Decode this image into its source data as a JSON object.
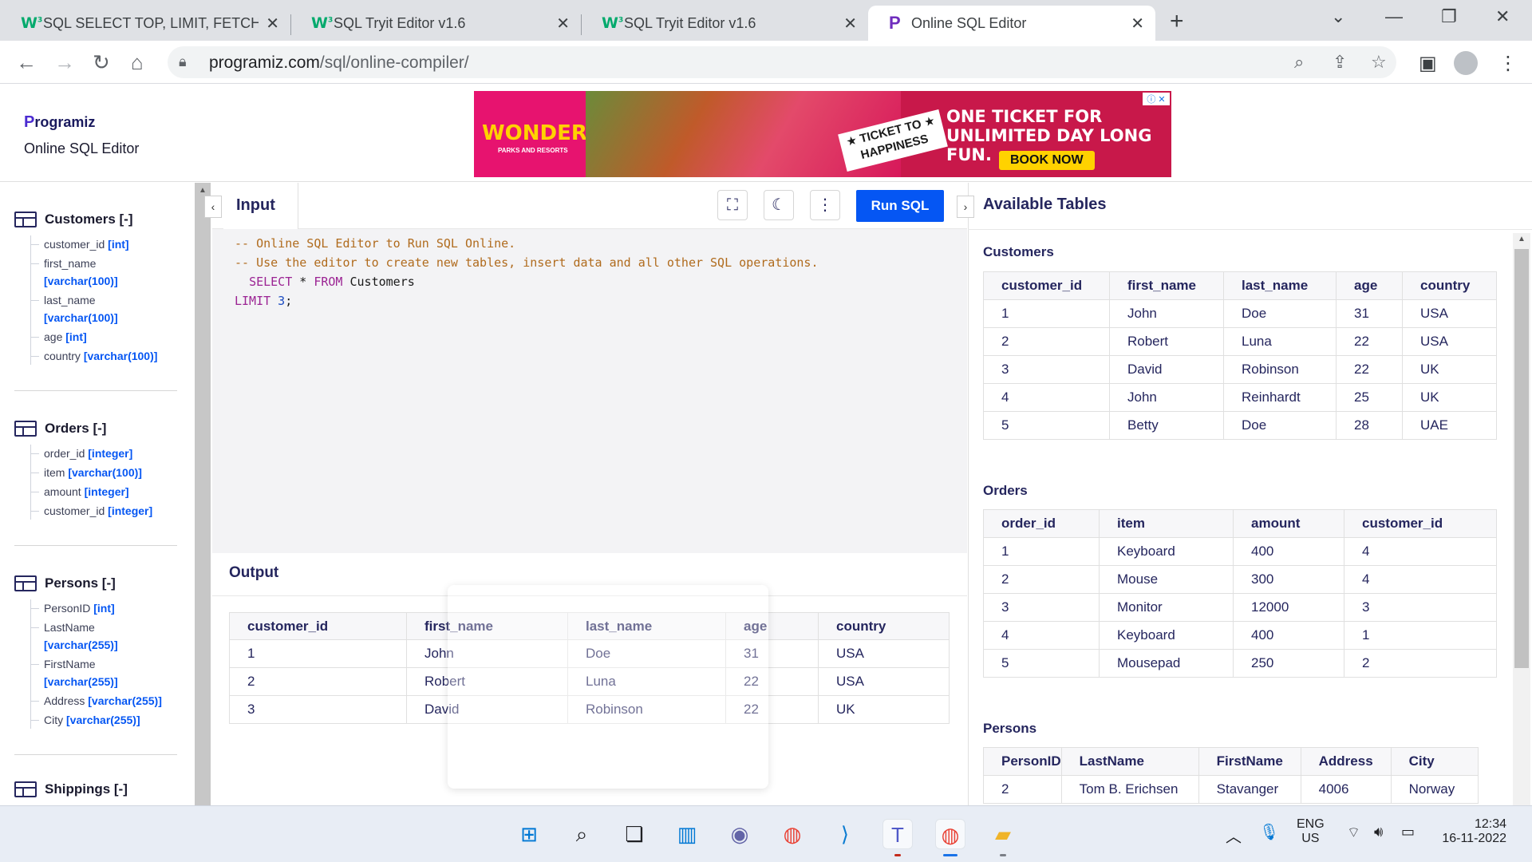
{
  "browser": {
    "tabs": [
      {
        "title": "SQL SELECT TOP, LIMIT, FETCH FI",
        "favicon": "w3schools-icon",
        "active": false
      },
      {
        "title": "SQL Tryit Editor v1.6",
        "favicon": "w3schools-icon",
        "active": false
      },
      {
        "title": "SQL Tryit Editor v1.6",
        "favicon": "w3schools-icon",
        "active": false
      },
      {
        "title": "Online SQL Editor",
        "favicon": "programiz-icon",
        "active": true
      }
    ],
    "url_host": "programiz.com",
    "url_path": "/sql/online-compiler/"
  },
  "header": {
    "logo_text": "rogramiz",
    "logo_letter": "P",
    "site_title": "Online SQL Editor"
  },
  "ad": {
    "brand": "WONDERLA",
    "brand_sub": "PARKS AND RESORTS",
    "ticket_line1": "★ TICKET TO ★",
    "ticket_line2": "HAPPINESS",
    "headline1": "ONE TICKET FOR",
    "headline2": "UNLIMITED DAY LONG FUN.",
    "cta": "BOOK NOW"
  },
  "sidebar": {
    "customers": {
      "title": "Customers [-]",
      "cols": [
        {
          "name": "customer_id",
          "type": "[int]"
        },
        {
          "name": "first_name",
          "type": "[varchar(100)]"
        },
        {
          "name": "last_name",
          "type": "[varchar(100)]"
        },
        {
          "name": "age",
          "type": "[int]"
        },
        {
          "name": "country",
          "type": "[varchar(100)]"
        }
      ]
    },
    "orders": {
      "title": "Orders [-]",
      "cols": [
        {
          "name": "order_id",
          "type": "[integer]"
        },
        {
          "name": "item",
          "type": "[varchar(100)]"
        },
        {
          "name": "amount",
          "type": "[integer]"
        },
        {
          "name": "customer_id",
          "type": "[integer]"
        }
      ]
    },
    "persons": {
      "title": "Persons [-]",
      "cols": [
        {
          "name": "PersonID",
          "type": "[int]"
        },
        {
          "name": "LastName",
          "type": "[varchar(255)]"
        },
        {
          "name": "FirstName",
          "type": "[varchar(255)]"
        },
        {
          "name": "Address",
          "type": "[varchar(255)]"
        },
        {
          "name": "City",
          "type": "[varchar(255)]"
        }
      ]
    },
    "shippings": {
      "title": "Shippings [-]"
    }
  },
  "editor": {
    "input_label": "Input",
    "run_label": "Run SQL",
    "code": {
      "line1": "-- Online SQL Editor to Run SQL Online.",
      "line2": "-- Use the editor to create new tables, insert data and all other SQL operations.",
      "l3_kw1": "SELECT",
      "l3_op": " * ",
      "l3_kw2": "FROM",
      "l3_table": " Customers",
      "l4_kw": "LIMIT",
      "l4_num": " 3",
      "l4_end": ";"
    }
  },
  "output": {
    "title": "Output",
    "headers": [
      "customer_id",
      "first_name",
      "last_name",
      "age",
      "country"
    ],
    "rows": [
      [
        "1",
        "John",
        "Doe",
        "31",
        "USA"
      ],
      [
        "2",
        "Robert",
        "Luna",
        "22",
        "USA"
      ],
      [
        "3",
        "David",
        "Robinson",
        "22",
        "UK"
      ]
    ]
  },
  "available": {
    "title": "Available Tables",
    "customers": {
      "title": "Customers",
      "headers": [
        "customer_id",
        "first_name",
        "last_name",
        "age",
        "country"
      ],
      "rows": [
        [
          "1",
          "John",
          "Doe",
          "31",
          "USA"
        ],
        [
          "2",
          "Robert",
          "Luna",
          "22",
          "USA"
        ],
        [
          "3",
          "David",
          "Robinson",
          "22",
          "UK"
        ],
        [
          "4",
          "John",
          "Reinhardt",
          "25",
          "UK"
        ],
        [
          "5",
          "Betty",
          "Doe",
          "28",
          "UAE"
        ]
      ]
    },
    "orders": {
      "title": "Orders",
      "headers": [
        "order_id",
        "item",
        "amount",
        "customer_id"
      ],
      "rows": [
        [
          "1",
          "Keyboard",
          "400",
          "4"
        ],
        [
          "2",
          "Mouse",
          "300",
          "4"
        ],
        [
          "3",
          "Monitor",
          "12000",
          "3"
        ],
        [
          "4",
          "Keyboard",
          "400",
          "1"
        ],
        [
          "5",
          "Mousepad",
          "250",
          "2"
        ]
      ]
    },
    "persons": {
      "title": "Persons",
      "headers": [
        "PersonID",
        "LastName",
        "FirstName",
        "Address",
        "City"
      ],
      "rows": [
        [
          "2",
          "Tom B. Erichsen",
          "Stavanger",
          "4006",
          "Norway"
        ]
      ]
    }
  },
  "taskbar": {
    "lang1": "ENG",
    "lang2": "US",
    "time": "12:34",
    "date": "16-11-2022"
  }
}
